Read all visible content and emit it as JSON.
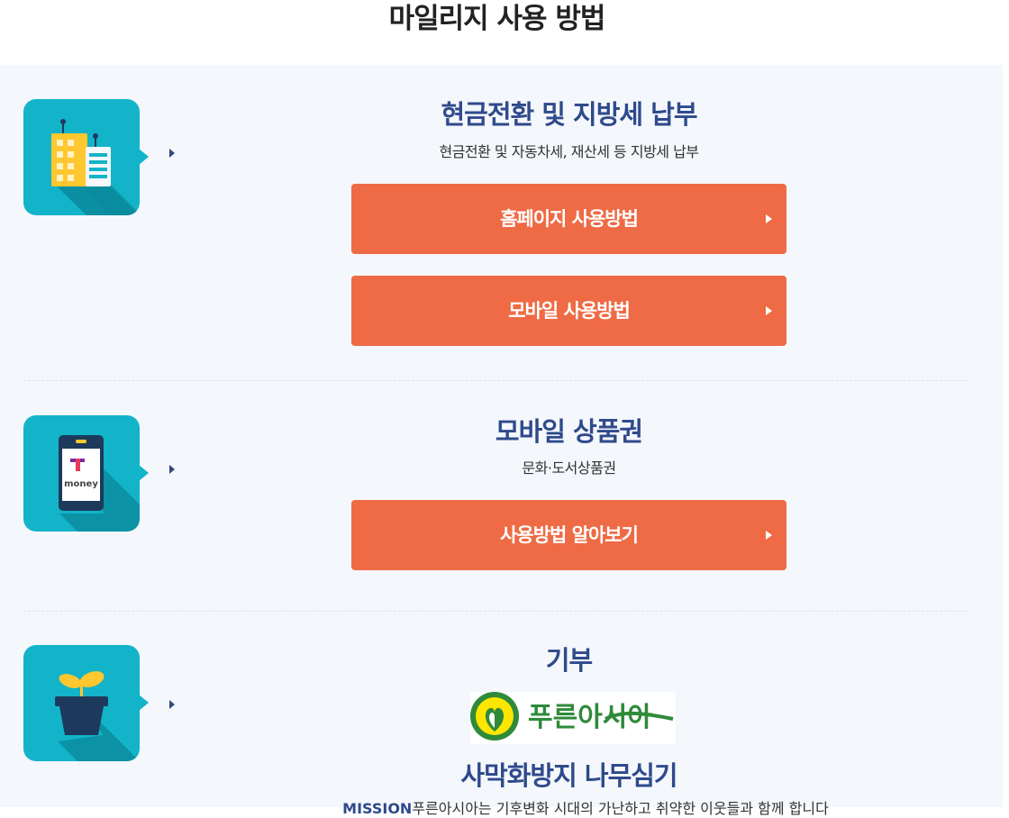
{
  "page_title": "마일리지 사용 방법",
  "sections": [
    {
      "icon": "building-icon",
      "title": "현금전환 및 지방세 납부",
      "subtitle": "현금전환 및 자동차세, 재산세 등 지방세 납부",
      "buttons": [
        "홈페이지 사용방법",
        "모바일 사용방법"
      ]
    },
    {
      "icon": "tmoney-phone-icon",
      "title": "모바일 상품권",
      "subtitle": "문화·도서상품권",
      "buttons": [
        "사용방법 알아보기"
      ],
      "icon_text": "money"
    },
    {
      "icon": "plant-pot-icon",
      "title": "기부",
      "logo_text": "푸른아시아",
      "subtitle2": "사막화방지 나무심기",
      "mission_label": "MISSION",
      "mission_text": "푸른아시아는 기후변화 시대의 가난하고 취약한 이웃들과 함께 합니다"
    }
  ],
  "colors": {
    "accent_button": "#ee6b45",
    "title_blue": "#2f4a8c",
    "icon_teal": "#13b4c9",
    "panel_bg": "#f4f7fb"
  }
}
